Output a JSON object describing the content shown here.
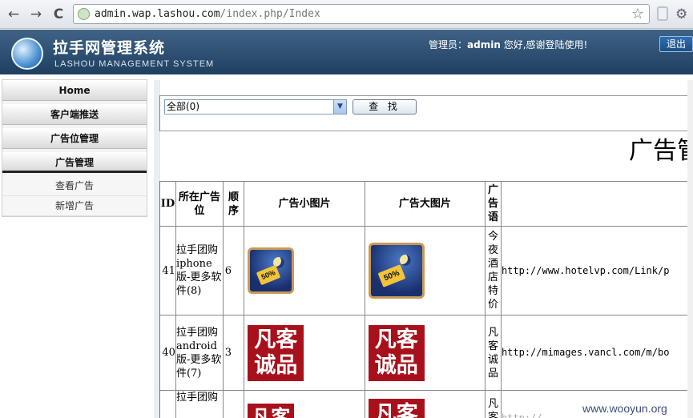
{
  "browser": {
    "back_icon": "←",
    "forward_icon": "→",
    "reload_icon": "C",
    "url_host": "admin.wap.lashou.com",
    "url_path": "/index.php/Index",
    "star_icon": "☆",
    "wrench_icon": "🔧"
  },
  "header": {
    "title": "拉手网管理系统",
    "subtitle": "LASHOU MANAGEMENT SYSTEM",
    "welcome_prefix": "管理员：",
    "admin_name": "admin",
    "welcome_suffix": " 您好,感谢登陆使用!",
    "logout_label": "退出"
  },
  "sidebar": {
    "items": [
      {
        "label": "Home"
      },
      {
        "label": "客户端推送"
      },
      {
        "label": "广告位管理"
      },
      {
        "label": "广告管理"
      }
    ],
    "sub_items": [
      {
        "label": "查看广告"
      },
      {
        "label": "新增广告"
      }
    ]
  },
  "filter": {
    "select_value": "全部(0)",
    "search_label": "查 找"
  },
  "page": {
    "title": "广告管"
  },
  "table": {
    "headers": {
      "id": "ID",
      "position": "所在广告位",
      "order": "顺序",
      "small_image": "广告小图片",
      "big_image": "广告大图片",
      "text": "广告语"
    },
    "rows": [
      {
        "id": "41",
        "position": "拉手团购iphone版-更多软件(8)",
        "order": "6",
        "thumb": "hotel",
        "tag_text": "50%",
        "text": "今夜酒店特价",
        "url": "http://www.hotelvp.com/Link/p"
      },
      {
        "id": "40",
        "position": "拉手团购android版-更多软件(7)",
        "order": "3",
        "thumb": "vancl",
        "vancl_line1": "凡客",
        "vancl_line2": "诚品",
        "text": "凡客诚品",
        "url": "http://mimages.vancl.com/m/bo"
      },
      {
        "id": "",
        "position": "拉手团购",
        "order": "",
        "thumb": "vancl",
        "vancl_line1": "凡客",
        "vancl_line2": "",
        "text": "凡客",
        "url": "http://"
      }
    ]
  },
  "watermark": "www.wooyun.org",
  "colors": {
    "banner": "#1f3f61",
    "vancl_red": "#a8111c"
  }
}
